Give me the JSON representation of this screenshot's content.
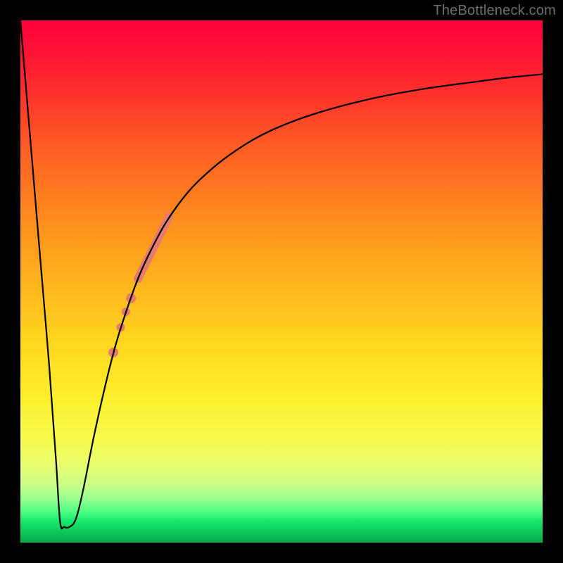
{
  "attribution": "TheBottleneck.com",
  "colors": {
    "frame": "#000000",
    "curve": "#000000",
    "marker_fill": "#e77a70",
    "marker_stroke": "#d9675e",
    "gradient_stops": [
      {
        "pct": 0,
        "hex": "#ff003c"
      },
      {
        "pct": 8,
        "hex": "#ff1a33"
      },
      {
        "pct": 16,
        "hex": "#ff3a2a"
      },
      {
        "pct": 24,
        "hex": "#ff5b24"
      },
      {
        "pct": 33,
        "hex": "#ff7a1f"
      },
      {
        "pct": 42,
        "hex": "#ff9a1c"
      },
      {
        "pct": 52,
        "hex": "#ffb91b"
      },
      {
        "pct": 62,
        "hex": "#ffd71f"
      },
      {
        "pct": 72,
        "hex": "#fdee2d"
      },
      {
        "pct": 80,
        "hex": "#f7fb4a"
      },
      {
        "pct": 85,
        "hex": "#eaff6e"
      },
      {
        "pct": 89,
        "hex": "#c9ff88"
      },
      {
        "pct": 92,
        "hex": "#8fff8f"
      },
      {
        "pct": 94,
        "hex": "#4dff82"
      },
      {
        "pct": 96,
        "hex": "#14e86a"
      },
      {
        "pct": 98,
        "hex": "#0bc95a"
      },
      {
        "pct": 100,
        "hex": "#06a94b"
      }
    ]
  },
  "chart_data": {
    "type": "line",
    "title": "",
    "xlabel": "",
    "ylabel": "",
    "xlim": [
      0,
      100
    ],
    "ylim": [
      0,
      100
    ],
    "grid": false,
    "legend": null,
    "comment": "x and y are normalized 0–100 to the plot-area box. y=0 is bottom, y=100 is top. Curve is a V-shaped dip near x≈8 followed by an asymptotic rise toward ~90.",
    "series": [
      {
        "name": "bottleneck-curve",
        "x": [
          0.0,
          2.0,
          4.0,
          5.5,
          6.8,
          7.6,
          8.4,
          9.4,
          10.6,
          12.0,
          14.0,
          16.0,
          18.0,
          20.0,
          22.5,
          25.0,
          28.0,
          32.0,
          36.0,
          40.0,
          45.0,
          50.0,
          56.0,
          63.0,
          70.0,
          78.0,
          86.0,
          93.0,
          100.0
        ],
        "y": [
          100.0,
          76.0,
          52.0,
          34.0,
          16.0,
          4.0,
          3.0,
          3.0,
          4.5,
          10.0,
          20.0,
          29.0,
          37.0,
          43.5,
          50.5,
          56.0,
          61.5,
          67.0,
          71.0,
          74.2,
          77.4,
          79.8,
          82.0,
          84.0,
          85.6,
          87.0,
          88.1,
          89.0,
          89.7
        ]
      }
    ],
    "markers": {
      "comment": "Salmon markers highlighting a segment of the rising branch. 'segment' is drawn as a thick line; 'dots' as circles. Coordinates normalized 0–100 like the series.",
      "segment": {
        "x": [
          22.5,
          28.5
        ],
        "y": [
          50.5,
          62.5
        ],
        "width": 12
      },
      "dots": [
        {
          "x": 21.2,
          "y": 46.8,
          "r": 7
        },
        {
          "x": 20.2,
          "y": 44.2,
          "r": 6
        },
        {
          "x": 19.2,
          "y": 41.2,
          "r": 6
        },
        {
          "x": 17.8,
          "y": 36.4,
          "r": 7
        }
      ]
    }
  }
}
